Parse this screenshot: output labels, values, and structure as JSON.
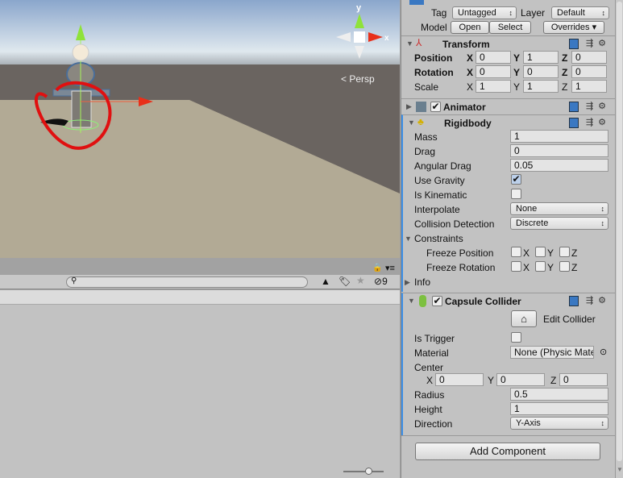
{
  "scene": {
    "view_label": "Persp",
    "gizmo_axes": [
      "y",
      "x"
    ]
  },
  "project_bar": {
    "search_placeholder": "",
    "hidden_count": "9"
  },
  "inspector": {
    "tag_label": "Tag",
    "tag_value": "Untagged",
    "layer_label": "Layer",
    "layer_value": "Default",
    "model_label": "Model",
    "open_btn": "Open",
    "select_btn": "Select",
    "overrides_btn": "Overrides",
    "transform": {
      "title": "Transform",
      "position": {
        "label": "Position",
        "x": "0",
        "y": "1",
        "z": "0"
      },
      "rotation": {
        "label": "Rotation",
        "x": "0",
        "y": "0",
        "z": "0"
      },
      "scale": {
        "label": "Scale",
        "x": "1",
        "y": "1",
        "z": "1"
      },
      "axis_x": "X",
      "axis_y": "Y",
      "axis_z": "Z"
    },
    "animator": {
      "title": "Animator",
      "enabled": true
    },
    "rigidbody": {
      "title": "Rigidbody",
      "mass_label": "Mass",
      "mass": "1",
      "drag_label": "Drag",
      "drag": "0",
      "angular_drag_label": "Angular Drag",
      "angular_drag": "0.05",
      "use_gravity_label": "Use Gravity",
      "use_gravity": true,
      "is_kinematic_label": "Is Kinematic",
      "is_kinematic": false,
      "interpolate_label": "Interpolate",
      "interpolate": "None",
      "collision_label": "Collision Detection",
      "collision": "Discrete",
      "constraints_label": "Constraints",
      "freeze_pos_label": "Freeze Position",
      "freeze_rot_label": "Freeze Rotation",
      "info_label": "Info"
    },
    "capsule": {
      "title": "Capsule Collider",
      "enabled": true,
      "edit_label": "Edit Collider",
      "is_trigger_label": "Is Trigger",
      "is_trigger": false,
      "material_label": "Material",
      "material": "None (Physic Mate",
      "center_label": "Center",
      "cx": "0",
      "cy": "0",
      "cz": "0",
      "radius_label": "Radius",
      "radius": "0.5",
      "height_label": "Height",
      "height": "1",
      "direction_label": "Direction",
      "direction": "Y-Axis"
    },
    "add_component": "Add Component"
  }
}
